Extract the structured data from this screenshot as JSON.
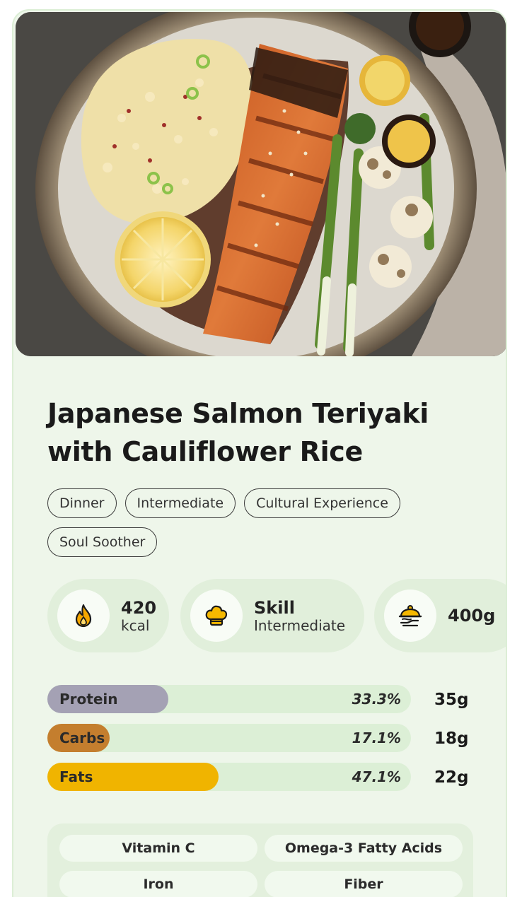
{
  "recipe": {
    "title": "Japanese Salmon Teriyaki with Cauliflower Rice",
    "tags": [
      "Dinner",
      "Intermediate",
      "Cultural Experience",
      "Soul Soother"
    ]
  },
  "stats": {
    "calories": {
      "value": "420",
      "unit": "kcal",
      "icon": "flame-icon"
    },
    "skill": {
      "label": "Skill",
      "value": "Intermediate",
      "icon": "chef-hat-icon"
    },
    "weight": {
      "value": "400g",
      "icon": "food-scale-icon"
    }
  },
  "macros": [
    {
      "name": "Protein",
      "percent_label": "33.3%",
      "fraction": 0.333,
      "grams": "35g",
      "color": "#a4a1b4"
    },
    {
      "name": "Carbs",
      "percent_label": "17.1%",
      "fraction": 0.171,
      "grams": "18g",
      "color": "#c47e2e"
    },
    {
      "name": "Fats",
      "percent_label": "47.1%",
      "fraction": 0.471,
      "grams": "22g",
      "color": "#f0b400"
    }
  ],
  "nutrients": [
    "Vitamin C",
    "Omega-3 Fatty Acids",
    "Iron",
    "Fiber"
  ],
  "colors": {
    "card_background": "#eef6ea",
    "stat_background": "#e1efdb",
    "bar_track": "#dcefd6",
    "flame": "#f5a700",
    "chef_hat": "#f5b800"
  }
}
